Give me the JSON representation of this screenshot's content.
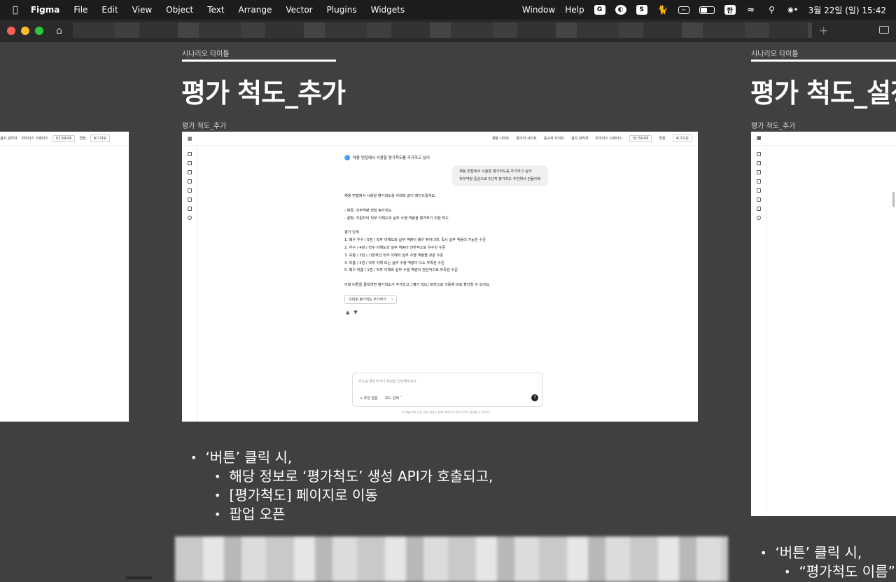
{
  "menubar": {
    "items": [
      "Figma",
      "File",
      "Edit",
      "View",
      "Object",
      "Text",
      "Arrange",
      "Vector",
      "Plugins",
      "Widgets"
    ],
    "right_items": [
      "Window",
      "Help"
    ],
    "clock": "3월 22일 (일) 15:42",
    "ime": "한"
  },
  "canvas": {
    "frame1": {
      "section_label": "시나리오 타이틀",
      "title": "평가 척도_추가",
      "frame_label": "평가 척도_추가"
    },
    "frame2": {
      "section_label": "시나리오 타이틀",
      "title": "평가 척도_설정",
      "frame_label": "평가 척도_추가"
    },
    "left_frame_top": {
      "nav1": "검사 관리자",
      "nav2": "마이더스 스페이스",
      "time": "01:59:06",
      "btn1": "연장",
      "btn2": "로그아웃"
    },
    "bullets1": {
      "b1": "‘버튼’ 클릭 시,",
      "b2": "해당 정보로 ‘평가척도’ 생성 API가 호출되고,",
      "b3": "[평가척도] 페이지로 이동",
      "b4": "팝업 오픈"
    },
    "bullets2": {
      "b1": "‘버튼’ 클릭 시,",
      "b2": "“평가척도 이름”"
    }
  },
  "inner_page": {
    "nav": [
      "채용 사이트",
      "평가자 사이트",
      "응시자 사이트",
      "검사 관리자"
    ],
    "space": "마이더스 스페이스",
    "time": "01:59:06",
    "extend": "연장",
    "logout": "로그아웃",
    "chat_title": "채용 면접에서 사용할 평가척도를 추가하고 싶어",
    "user_msg1": "채용 면접에서 사용할 평가척도를 추가하고 싶어",
    "user_msg2": "직무역량 중심으로 5단계 평가척도 추천해서 만들어줘",
    "reply_intro": "채용 면접에서 사용할 평가척도를 아래와 같이 제안드릴게요.",
    "reply_title": "- 제목: 직무역량 면접 평가척도",
    "reply_desc": "- 설명: 지원자의 직무 이해도와 실무 수행 역량을 평가하기 위한 척도",
    "steps_label": "평가 단계",
    "steps": [
      "1. 매우 우수 / 5점 / 직무 이해도와 실무 역량이 매우 뛰어나며, 즉시 실무 적용이 가능한 수준",
      "2. 우수 / 4점 / 직무 이해도와 실무 역량이 전반적으로 우수한 수준",
      "3. 보통 / 3점 / 기본적인 직무 이해와 실무 수행 역량을 갖춘 수준",
      "4. 미흡 / 2점 / 직무 이해 또는 실무 수행 역량이 다소 부족한 수준",
      "5. 매우 미흡 / 1점 / 직무 이해와 실무 수행 역량이 전반적으로 부족한 수준"
    ],
    "footer_msg": "아래 버튼을 클릭하면 평가척도가 추가되고, [평가 척도] 화면으로 이동해 바로 확인할 수 있어요.",
    "add_button": "이대로 평가척도 추가하기",
    "input_placeholder": "카드를 클릭하거나 채팅을 입력해주세요.",
    "recommend": "+ 추천 질문",
    "model": "모드 선택",
    "disclaimer": "AI Agent의 자동 분석 결과는 실제 데이터와 일부 차이가 발생할 수 있어요."
  }
}
